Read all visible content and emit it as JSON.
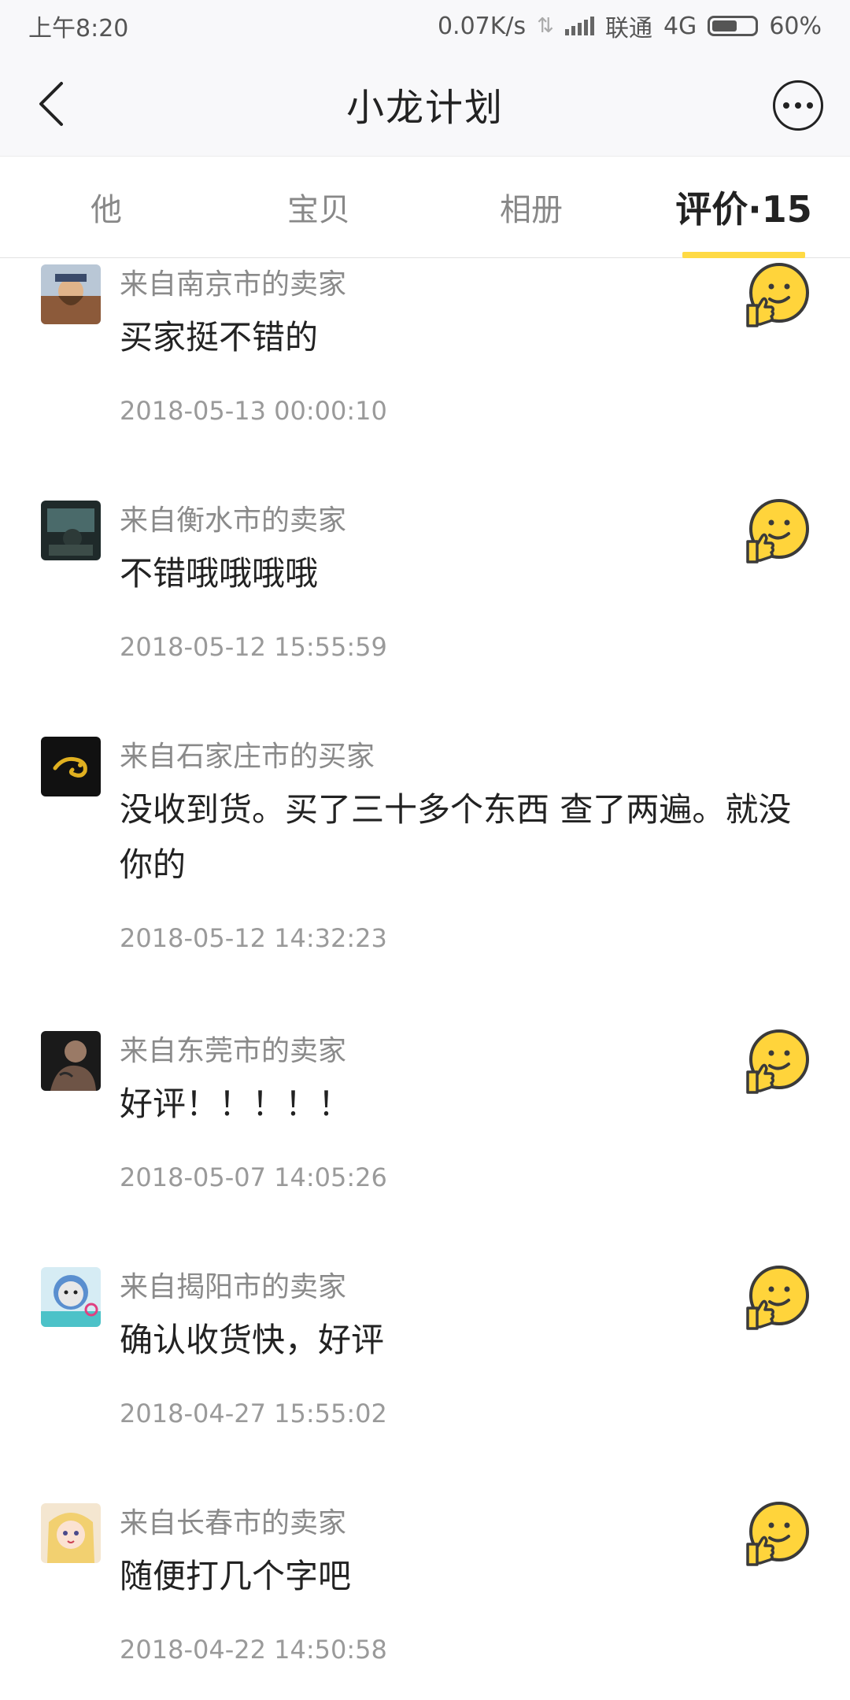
{
  "status_bar": {
    "time": "上午8:20",
    "network_speed": "0.07K/s",
    "carrier": "联通",
    "network_type": "4G",
    "battery": "60%",
    "battery_level": 0.6
  },
  "nav": {
    "title": "小龙计划"
  },
  "tabs": [
    {
      "label": "他"
    },
    {
      "label": "宝贝"
    },
    {
      "label": "相册"
    },
    {
      "label": "评价·15"
    }
  ],
  "active_tab": 3,
  "colors": {
    "accent": "#ffda44",
    "emoji_face": "#ffd43b",
    "emoji_outline": "#3a3a3a"
  },
  "reviews": [
    {
      "source": "来自南京市的卖家",
      "content": "买家挺不错的",
      "time": "2018-05-13 00:00:10",
      "rating_icon": "thumbs-up-emoji-icon",
      "avatar_icon": "bearded-man-avatar"
    },
    {
      "source": "来自衡水市的卖家",
      "content": "不错哦哦哦哦",
      "time": "2018-05-12 15:55:59",
      "rating_icon": "thumbs-up-emoji-icon",
      "avatar_icon": "dark-photo-avatar"
    },
    {
      "source": "来自石家庄市的买家",
      "content": "没收到货。买了三十多个东西  查了两遍。就没你的",
      "time": "2018-05-12 14:32:23",
      "rating_icon": "",
      "avatar_icon": "chameleon-logo-avatar"
    },
    {
      "source": "来自东莞市的卖家",
      "content": "好评！！！！！",
      "time": "2018-05-07 14:05:26",
      "rating_icon": "thumbs-up-emoji-icon",
      "avatar_icon": "tattooed-man-avatar"
    },
    {
      "source": "来自揭阳市的卖家",
      "content": "确认收货快，好评",
      "time": "2018-04-27 15:55:02",
      "rating_icon": "thumbs-up-emoji-icon",
      "avatar_icon": "seal-cartoon-avatar"
    },
    {
      "source": "来自长春市的卖家",
      "content": "随便打几个字吧",
      "time": "2018-04-22 14:50:58",
      "rating_icon": "thumbs-up-emoji-icon",
      "avatar_icon": "anime-girl-avatar"
    }
  ]
}
